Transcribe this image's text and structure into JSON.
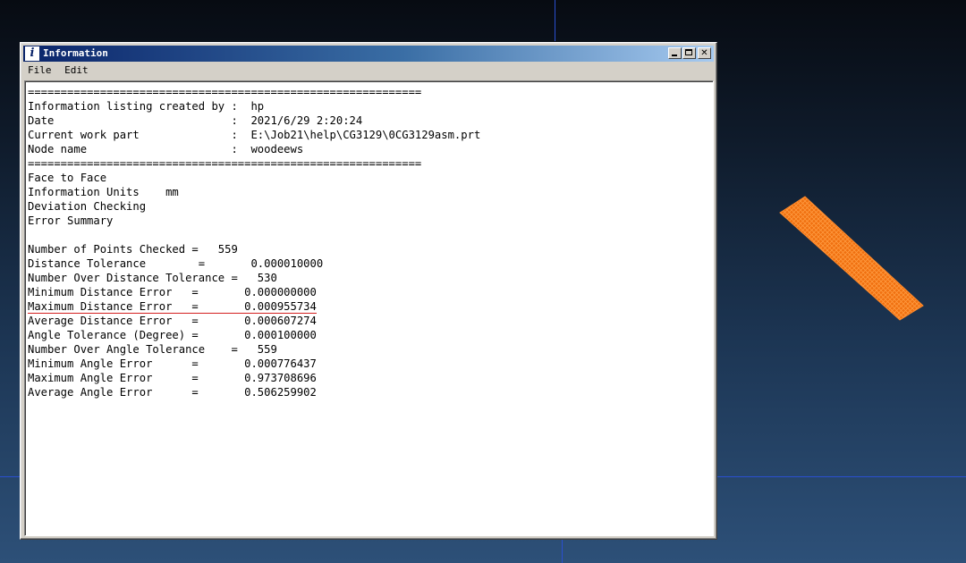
{
  "window": {
    "title": "Information",
    "icon": "info-icon",
    "controls": [
      "minimize-icon",
      "maximize-icon",
      "close-icon"
    ]
  },
  "menu": {
    "file": "File",
    "edit": "Edit"
  },
  "listing": {
    "lines": [
      "============================================================",
      "Information listing created by :  hp",
      "Date                           :  2021/6/29 2:20:24",
      "Current work part              :  E:\\Job21\\help\\CG3129\\0CG3129asm.prt",
      "Node name                      :  woodeews",
      "============================================================",
      "Face to Face",
      "Information Units    mm",
      "Deviation Checking",
      "Error Summary",
      "",
      "Number of Points Checked =   559",
      "Distance Tolerance        =       0.000010000",
      "Number Over Distance Tolerance =   530",
      "Minimum Distance Error   =       0.000000000",
      "Maximum Distance Error   =       0.000955734",
      "Average Distance Error   =       0.000607274",
      "Angle Tolerance (Degree) =       0.000100000",
      "Number Over Angle Tolerance    =   559",
      "Minimum Angle Error      =       0.000776437",
      "Maximum Angle Error      =       0.973708696",
      "Average Angle Error      =       0.506259902"
    ],
    "highlighted_line": 15
  },
  "colors": {
    "highlight_underline": "#d42020",
    "part_model": "#ff7a1a"
  }
}
